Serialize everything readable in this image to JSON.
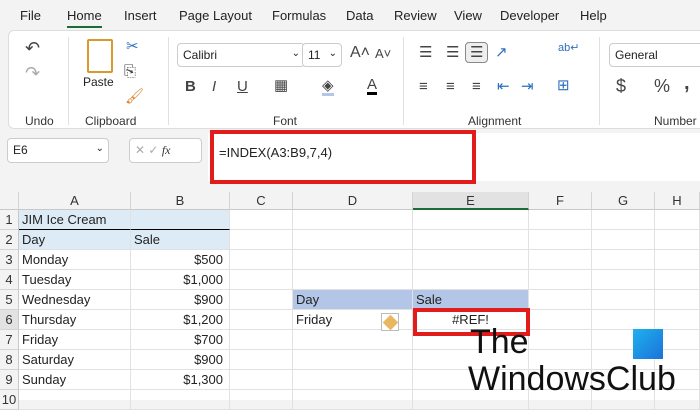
{
  "tabs": [
    "File",
    "Home",
    "Insert",
    "Page Layout",
    "Formulas",
    "Data",
    "Review",
    "View",
    "Developer",
    "Help"
  ],
  "ribbon": {
    "groups": {
      "undo": "Undo",
      "clipboard": "Clipboard",
      "font": "Font",
      "alignment": "Alignment",
      "number": "Number"
    },
    "paste_label": "Paste",
    "font_name": "Calibri",
    "font_size": "11",
    "number_format": "General",
    "bold": "B",
    "italic": "I",
    "underline": "U",
    "font_color": "A",
    "currency": "$",
    "percent": "%",
    "comma": ","
  },
  "formula_bar": {
    "name_box": "E6",
    "fx": "fx",
    "formula": "=INDEX(A3:B9,7,4)"
  },
  "columns": [
    "A",
    "B",
    "C",
    "D",
    "E",
    "F",
    "G",
    "H"
  ],
  "rows": [
    "1",
    "2",
    "3",
    "4",
    "5",
    "6",
    "7",
    "8",
    "9",
    "10"
  ],
  "cells": {
    "A1": "JIM Ice Cream",
    "A2": "Day",
    "B2": "Sale",
    "A3": "Monday",
    "B3": "$500",
    "A4": "Tuesday",
    "B4": "$1,000",
    "A5": "Wednesday",
    "B5": "$900",
    "A6": "Thursday",
    "B6": "$1,200",
    "A7": "Friday",
    "B7": "$700",
    "A8": "Saturday",
    "B8": "$900",
    "A9": "Sunday",
    "B9": "$1,300",
    "D5": "Day",
    "E5": "Sale",
    "D6": "Friday",
    "E6": "#REF!"
  },
  "watermark": {
    "line1": "The",
    "line2": "WindowsClub"
  },
  "colors": {
    "accent": "#1e6b3a",
    "highlight": "#e21b1b",
    "header_fill": "#ddebf7",
    "lookup_fill": "#b4c6e7"
  }
}
